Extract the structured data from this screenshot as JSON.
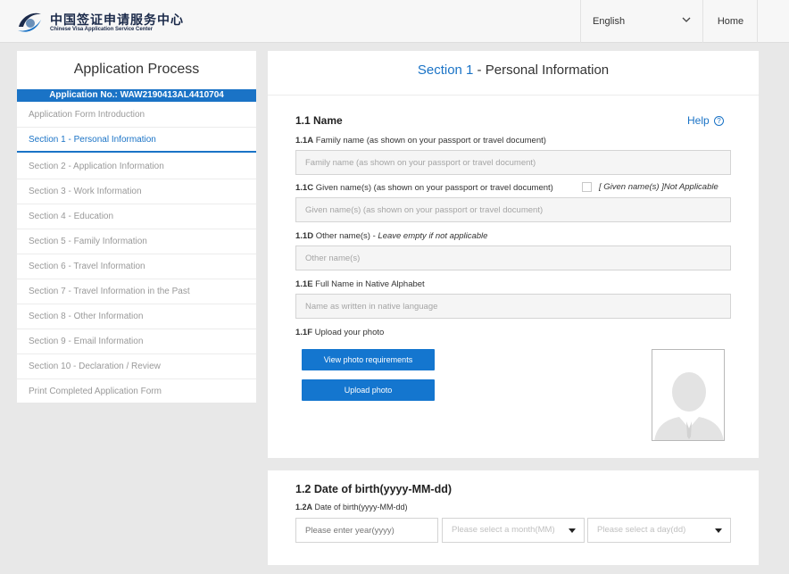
{
  "header": {
    "logo_cn": "中国签证申请服务中心",
    "logo_en": "Chinese Visa Application Service Center",
    "language": "English",
    "home": "Home"
  },
  "sidebar": {
    "title": "Application Process",
    "application_no": "Application No.: WAW2190413AL4410704",
    "items": [
      {
        "label": "Application Form Introduction",
        "active": false
      },
      {
        "label": "Section 1 - Personal Information",
        "active": true
      },
      {
        "label": "Section 2 - Application Information",
        "active": false
      },
      {
        "label": "Section 3 - Work Information",
        "active": false
      },
      {
        "label": "Section 4 - Education",
        "active": false
      },
      {
        "label": "Section 5 - Family Information",
        "active": false
      },
      {
        "label": "Section 6 - Travel Information",
        "active": false
      },
      {
        "label": "Section 7 - Travel Information in the Past",
        "active": false
      },
      {
        "label": "Section 8 - Other Information",
        "active": false
      },
      {
        "label": "Section 9 - Email Information",
        "active": false
      },
      {
        "label": "Section 10 - Declaration / Review",
        "active": false
      },
      {
        "label": "Print Completed Application Form",
        "active": false
      }
    ]
  },
  "section": {
    "number": "Section 1",
    "title": " - Personal Information",
    "name_heading": "1.1 Name",
    "help": "Help",
    "help_icon": "?",
    "family_name": {
      "code": "1.1A",
      "label": " Family name (as shown on your passport or travel document)",
      "placeholder": "Family name (as shown on your passport or travel document)",
      "value": ""
    },
    "given_name": {
      "code": "1.1C",
      "label": " Given name(s) (as shown on your passport or travel document)",
      "placeholder": "Given name(s) (as shown on your passport or travel document)",
      "value": "",
      "not_applicable": "[ Given name(s) ]Not Applicable",
      "not_applicable_checked": false
    },
    "other_name": {
      "code": "1.1D",
      "label": " Other name(s) - ",
      "hint": "Leave empty if not applicable",
      "placeholder": "Other name(s)",
      "value": ""
    },
    "native_name": {
      "code": "1.1E",
      "label": " Full Name in Native Alphabet",
      "placeholder": "Name as written in native language",
      "value": ""
    },
    "photo": {
      "code": "1.1F",
      "label": " Upload your photo",
      "requirements_button": "View photo requirements",
      "upload_button": "Upload photo",
      "placeholder_icon": "person-silhouette-icon"
    },
    "dob": {
      "heading": "1.2 Date of birth(yyyy-MM-dd)",
      "code": "1.2A",
      "label": " Date of birth(yyyy-MM-dd)",
      "year_placeholder": "Please enter year(yyyy)",
      "year_value": "",
      "month_placeholder": "Please select a month(MM)",
      "day_placeholder": "Please select a day(dd)"
    }
  },
  "colors": {
    "accent": "#1a73c6",
    "button": "#1476cf",
    "background": "#e8e8e8"
  }
}
